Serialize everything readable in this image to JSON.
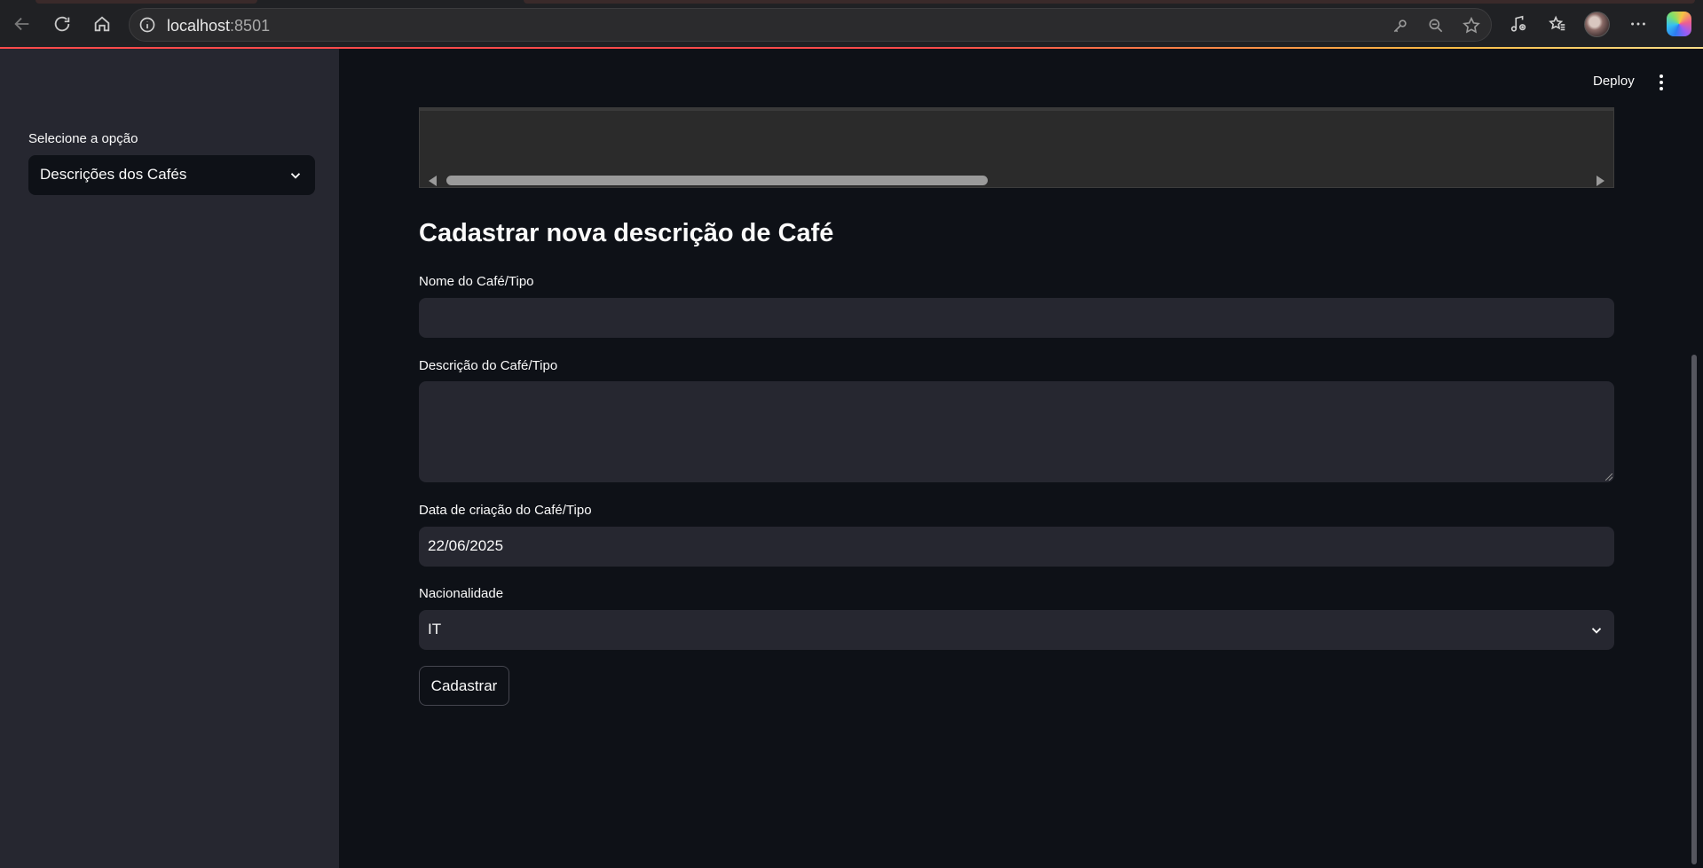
{
  "browser": {
    "url_host": "localhost",
    "url_port": ":8501"
  },
  "sidebar": {
    "select_label": "Selecione a opção",
    "select_value": "Descrições dos Cafés"
  },
  "header": {
    "deploy_label": "Deploy"
  },
  "form": {
    "title": "Cadastrar nova descrição de Café",
    "name_label": "Nome do Café/Tipo",
    "name_value": "",
    "description_label": "Descrição do Café/Tipo",
    "description_value": "",
    "date_label": "Data de criação do Café/Tipo",
    "date_value": "22/06/2025",
    "nationality_label": "Nacionalidade",
    "nationality_value": "IT",
    "submit_label": "Cadastrar"
  },
  "colors": {
    "accent": "#ff4b4b",
    "background": "#0e1117",
    "sidebar_bg": "#262730",
    "input_bg": "#262730"
  },
  "icons": [
    "back-icon",
    "reload-icon",
    "home-icon",
    "info-icon",
    "key-icon",
    "zoom-out-icon",
    "star-icon",
    "media-icon",
    "favorites-icon",
    "more-icon",
    "copilot-icon",
    "chevron-down-icon",
    "kebab-menu-icon"
  ]
}
